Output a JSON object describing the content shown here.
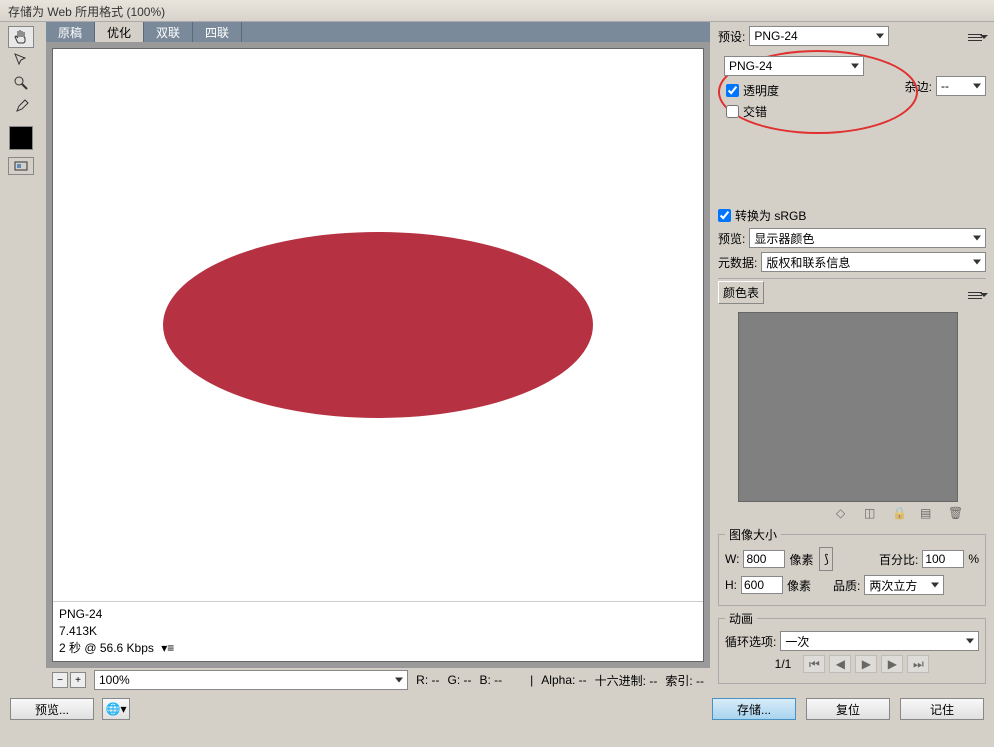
{
  "window": {
    "title": "存储为 Web 所用格式 (100%)"
  },
  "tabs": {
    "original": "原稿",
    "optimized": "优化",
    "twoUp": "双联",
    "fourUp": "四联"
  },
  "info": {
    "format": "PNG-24",
    "size": "7.413K",
    "speed": "2 秒 @ 56.6 Kbps"
  },
  "zoom": {
    "value": "100%",
    "r": "R: --",
    "g": "G: --",
    "b": "B: --",
    "alpha": "Alpha: --",
    "hex": "十六进制: --",
    "index": "索引: --"
  },
  "right": {
    "presetLabel": "预设:",
    "presetValue": "PNG-24",
    "formatValue": "PNG-24",
    "transparency": "透明度",
    "interlaced": "交错",
    "matteLabel": "杂边:",
    "matteValue": "--",
    "convertSRGB": "转换为 sRGB",
    "previewLabel": "预览:",
    "previewValue": "显示器颜色",
    "metadataLabel": "元数据:",
    "metadataValue": "版权和联系信息",
    "colorTableLabel": "颜色表",
    "imageSize": {
      "legend": "图像大小",
      "wLabel": "W:",
      "wValue": "800",
      "hLabel": "H:",
      "hValue": "600",
      "pxUnit": "像素",
      "percentLabel": "百分比:",
      "percentValue": "100",
      "percentUnit": "%",
      "qualityLabel": "品质:",
      "qualityValue": "两次立方"
    },
    "animation": {
      "legend": "动画",
      "loopLabel": "循环选项:",
      "loopValue": "一次",
      "frame": "1/1"
    }
  },
  "buttons": {
    "preview": "预览...",
    "save": "存储...",
    "reset": "复位",
    "remember": "记住"
  }
}
